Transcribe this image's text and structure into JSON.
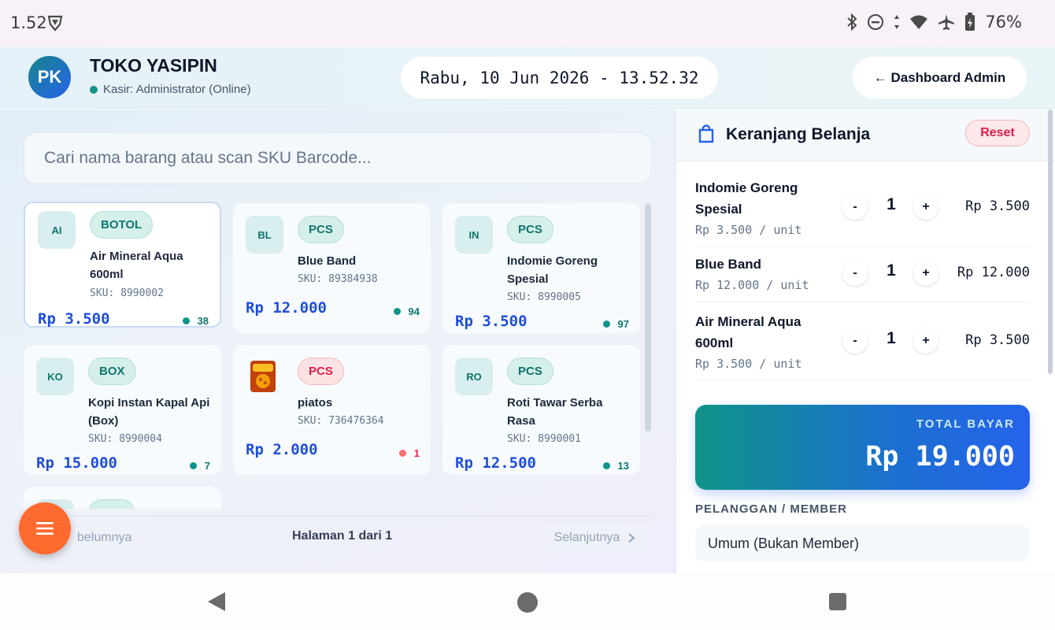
{
  "status_bar": {
    "time": "1.52",
    "battery": "76%"
  },
  "header": {
    "avatar_initials": "PK",
    "store_name": "TOKO YASIPIN",
    "cashier": "Kasir: Administrator (Online)",
    "datetime": "Rabu, 10 Jun 2026 - 13.52.32",
    "dashboard_button": "← Dashboard Admin"
  },
  "search": {
    "placeholder": "Cari nama barang atau scan SKU Barcode..."
  },
  "products": [
    {
      "abbr": "AI",
      "unit": "BOTOL",
      "name": "Air Mineral Aqua 600ml",
      "sku": "SKU: 8990002",
      "price": "Rp 3.500",
      "stock": "38"
    },
    {
      "abbr": "BL",
      "unit": "PCS",
      "name": "Blue Band",
      "sku": "SKU: 89384938",
      "price": "Rp 12.000",
      "stock": "94"
    },
    {
      "abbr": "IN",
      "unit": "PCS",
      "name": "Indomie Goreng Spesial",
      "sku": "SKU: 8990005",
      "price": "Rp 3.500",
      "stock": "97"
    },
    {
      "abbr": "KO",
      "unit": "BOX",
      "name": "Kopi Instan Kapal Api (Box)",
      "sku": "SKU: 8990004",
      "price": "Rp 15.000",
      "stock": "7"
    },
    {
      "abbr": "",
      "unit": "PCS",
      "name": "piatos",
      "sku": "SKU: 736476364",
      "price": "Rp 2.000",
      "stock": "1"
    },
    {
      "abbr": "RO",
      "unit": "PCS",
      "name": "Roti Tawar Serba Rasa",
      "sku": "SKU: 8990001",
      "price": "Rp 12.500",
      "stock": "13"
    }
  ],
  "pager": {
    "prev": "belumnya",
    "info": "Halaman 1 dari 1",
    "next": "Selanjutnya"
  },
  "cart": {
    "title": "Keranjang Belanja",
    "reset": "Reset",
    "items": [
      {
        "name": "Indomie Goreng Spesial",
        "unit_price": "Rp 3.500 / unit",
        "qty": "1",
        "total": "Rp 3.500"
      },
      {
        "name": "Blue Band",
        "unit_price": "Rp 12.000 / unit",
        "qty": "1",
        "total": "Rp 12.000"
      },
      {
        "name": "Air Mineral Aqua 600ml",
        "unit_price": "Rp 3.500 / unit",
        "qty": "1",
        "total": "Rp 3.500"
      }
    ],
    "minus": "-",
    "plus": "+",
    "total_label": "TOTAL BAYAR",
    "total_value": "Rp 19.000",
    "customer_label": "PELANGGAN / MEMBER",
    "customer_value": "Umum (Bukan Member)"
  },
  "colors": {
    "primary": "#2563eb",
    "teal": "#0f766e",
    "danger": "#e11d48",
    "fab": "#ff6a2e"
  }
}
